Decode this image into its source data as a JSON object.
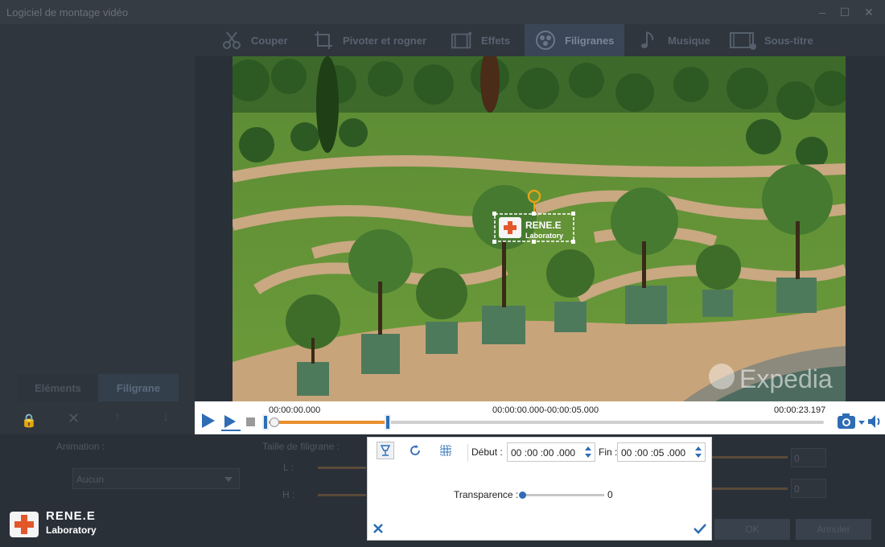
{
  "window": {
    "title": "Logiciel de montage vidéo"
  },
  "toolbar": {
    "items": [
      {
        "label": "Couper",
        "icon": "scissors-icon"
      },
      {
        "label": "Pivoter et rogner",
        "icon": "crop-icon"
      },
      {
        "label": "Effets",
        "icon": "film-effects-icon"
      },
      {
        "label": "Filigranes",
        "icon": "watermark-icon"
      },
      {
        "label": "Musique",
        "icon": "music-icon"
      },
      {
        "label": "Sous-titre",
        "icon": "subtitle-icon"
      }
    ],
    "active": "Filigranes"
  },
  "video": {
    "watermark_text_line1": "RENE.E",
    "watermark_text_line2": "Laboratory",
    "source_watermark": "Expedia"
  },
  "player": {
    "current_time": "00:00:00.000",
    "range": "00:00:00.000-00:00:05.000",
    "duration": "00:00:23.197",
    "selection_fraction": 0.215
  },
  "left": {
    "tabs": [
      "Eléments",
      "Filigrane"
    ],
    "active_tab": "Filigrane",
    "animation_label": "Animation :",
    "animation_value": "Aucun",
    "size_label": "Taille de filigrane :",
    "l_label": "L :",
    "h_label": "H :",
    "value_l": "0",
    "value_h": "0"
  },
  "popup": {
    "debut_label": "Début :",
    "debut_value": "00 :00 :00 .000",
    "fin_label": "Fin :",
    "fin_value": "00 :00 :05 .000",
    "transparence_label": "Transparence :",
    "transparence_value": "0"
  },
  "buttons": {
    "ok": "OK",
    "cancel": "Annuler"
  },
  "brand": {
    "line1": "RENE.E",
    "line2": "Laboratory"
  }
}
